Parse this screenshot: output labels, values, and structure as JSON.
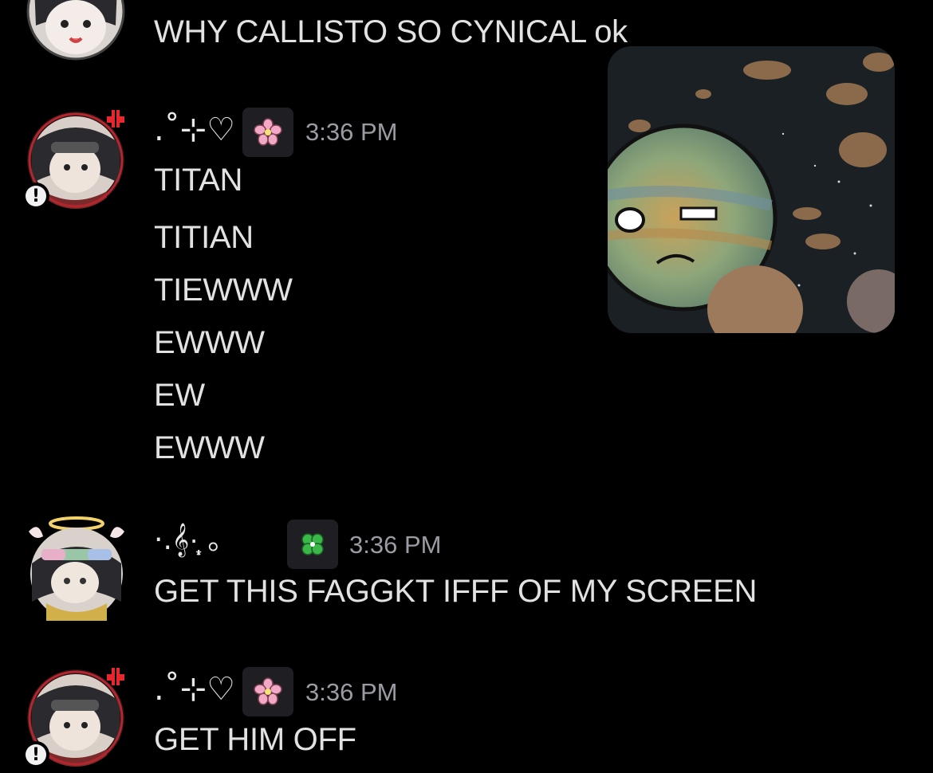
{
  "messages": [
    {
      "text_lines": [
        "WHY CALLISTO SO CYNICAL ok"
      ]
    },
    {
      "author": ".˚⊹♡",
      "tag_icon": "cherry-blossom-icon",
      "timestamp": "3:36 PM",
      "text_lines": [
        "TITAN",
        "TITIAN",
        "TIEWWW",
        "EWWW",
        "EW",
        "EWWW"
      ]
    },
    {
      "author": "·.𝄞·̩͙ ｡",
      "tag_icon": "four-leaf-clover-icon",
      "timestamp": "3:36 PM",
      "text_lines": [
        "GET THIS FAGGKT IFFF OF MY SCREEN"
      ]
    },
    {
      "author": ".˚⊹♡",
      "tag_icon": "cherry-blossom-icon",
      "timestamp": "3:36 PM",
      "text_lines": [
        "GET HIM OFF"
      ]
    }
  ],
  "badges": {
    "warning_symbol": "!"
  },
  "colors": {
    "background": "#000000",
    "text": "#e2e2e2",
    "timestamp": "#9b9ba3",
    "chip": "#1f1f23"
  }
}
